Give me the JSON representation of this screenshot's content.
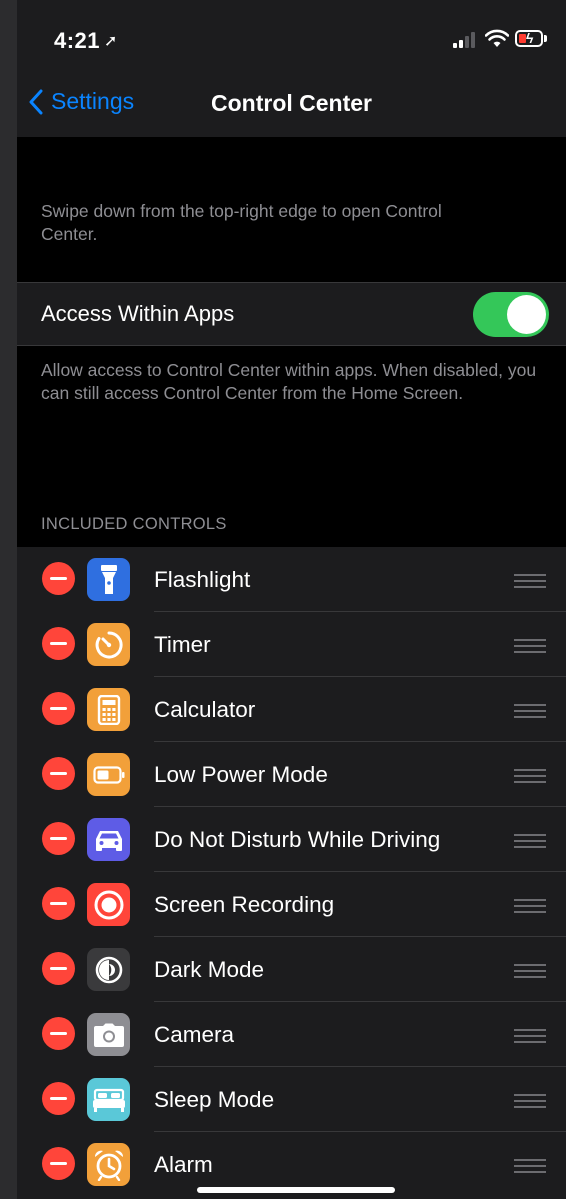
{
  "status": {
    "time": "4:21"
  },
  "nav": {
    "back_label": "Settings",
    "title": "Control Center"
  },
  "intro_text": "Swipe down from the top-right edge to open Control Center.",
  "access": {
    "label": "Access Within Apps",
    "enabled": true
  },
  "access_desc": "Allow access to Control Center within apps. When disabled, you can still access Control Center from the Home Screen.",
  "section_header": "INCLUDED CONTROLS",
  "controls": [
    {
      "label": "Flashlight",
      "icon": "flashlight-icon",
      "color": "#2f6fe0"
    },
    {
      "label": "Timer",
      "icon": "timer-icon",
      "color": "#f2a03a"
    },
    {
      "label": "Calculator",
      "icon": "calculator-icon",
      "color": "#f2a03a"
    },
    {
      "label": "Low Power Mode",
      "icon": "battery-icon",
      "color": "#f2a03a"
    },
    {
      "label": "Do Not Disturb While Driving",
      "icon": "car-icon",
      "color": "#5e5ce6"
    },
    {
      "label": "Screen Recording",
      "icon": "record-icon",
      "color": "#ff453a"
    },
    {
      "label": "Dark Mode",
      "icon": "dark-mode-icon",
      "color": "#3a3a3c"
    },
    {
      "label": "Camera",
      "icon": "camera-icon",
      "color": "#8e8e93"
    },
    {
      "label": "Sleep Mode",
      "icon": "bed-icon",
      "color": "#5ac8d8"
    },
    {
      "label": "Alarm",
      "icon": "alarm-icon",
      "color": "#f2a03a"
    }
  ]
}
